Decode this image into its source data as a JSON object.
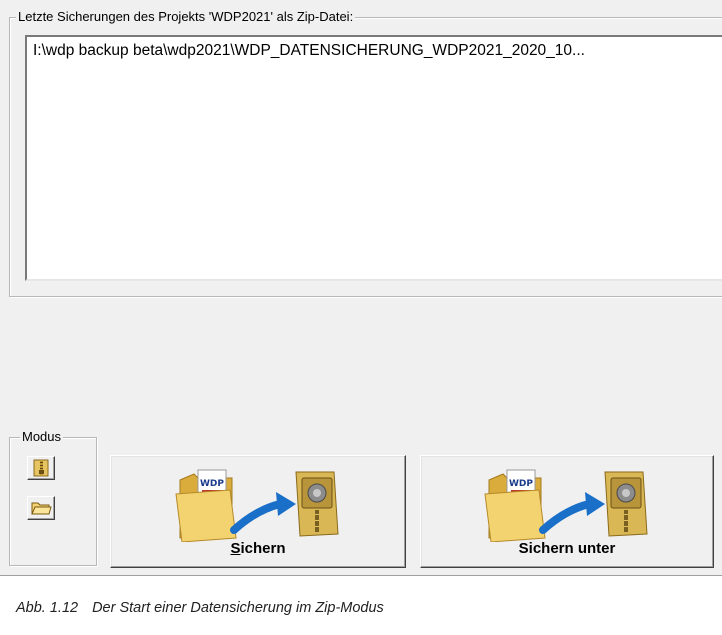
{
  "backup_group": {
    "title": "Letzte Sicherungen des Projekts 'WDP2021' als Zip-Datei:",
    "items": [
      "I:\\wdp backup beta\\wdp2021\\WDP_DATENSICHERUNG_WDP2021_2020_10..."
    ]
  },
  "modus_group": {
    "title": "Modus",
    "zip_mode_icon": "zip-archive-icon",
    "folder_mode_icon": "folder-open-icon"
  },
  "buttons": {
    "sichern": {
      "accel": "S",
      "rest": "ichern"
    },
    "sichern_unter": {
      "label": "Sichern unter"
    },
    "art_icons": [
      "folder-wdp-icon",
      "arrow-right-icon",
      "zip-vault-icon"
    ],
    "folder_badge_text": "WDP"
  },
  "caption": {
    "number": "Abb. 1.12",
    "text": "Der Start einer Datensicherung im Zip-Modus"
  },
  "colors": {
    "dialog_bg": "#f0f0f0",
    "list_bg": "#ffffff",
    "folder_yellow": "#e9c15a",
    "arrow_blue": "#1a6fc9",
    "vault_gold": "#c9a544"
  }
}
